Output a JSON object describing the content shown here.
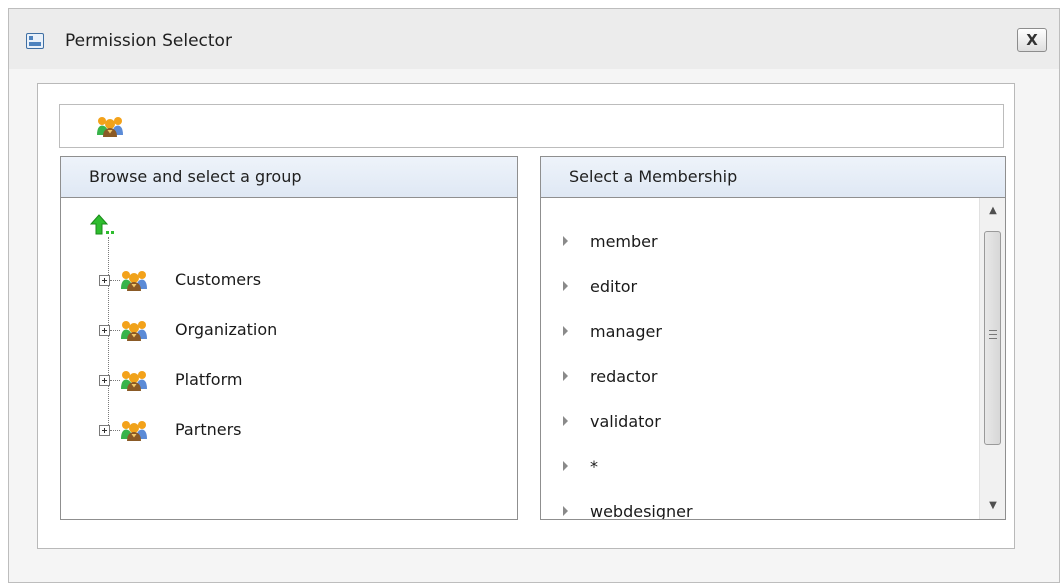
{
  "window": {
    "title": "Permission Selector",
    "close_label": "X"
  },
  "toolbar": {
    "icon": "group-icon"
  },
  "left_panel": {
    "header": "Browse and select a group",
    "up_icon": "up-level-icon",
    "groups": [
      {
        "label": "Customers",
        "expander": "+"
      },
      {
        "label": "Organization",
        "expander": "+"
      },
      {
        "label": "Platform",
        "expander": "+"
      },
      {
        "label": "Partners",
        "expander": "+"
      }
    ]
  },
  "right_panel": {
    "header": "Select a Membership",
    "memberships": [
      "member",
      "editor",
      "manager",
      "redactor",
      "validator",
      "*",
      "webdesigner"
    ],
    "scrollbar": {
      "up_icon": "scroll-up-arrow",
      "down_icon": "scroll-down-arrow",
      "grip_icon": "scroll-grip-icon"
    }
  },
  "colors": {
    "header_bg": "#dfe8f4",
    "up_arrow": "#2ebd2e",
    "group_orange": "#f3a21a",
    "group_blue": "#5b8bd7",
    "group_green": "#38b34a",
    "group_brown": "#8a5a26"
  }
}
